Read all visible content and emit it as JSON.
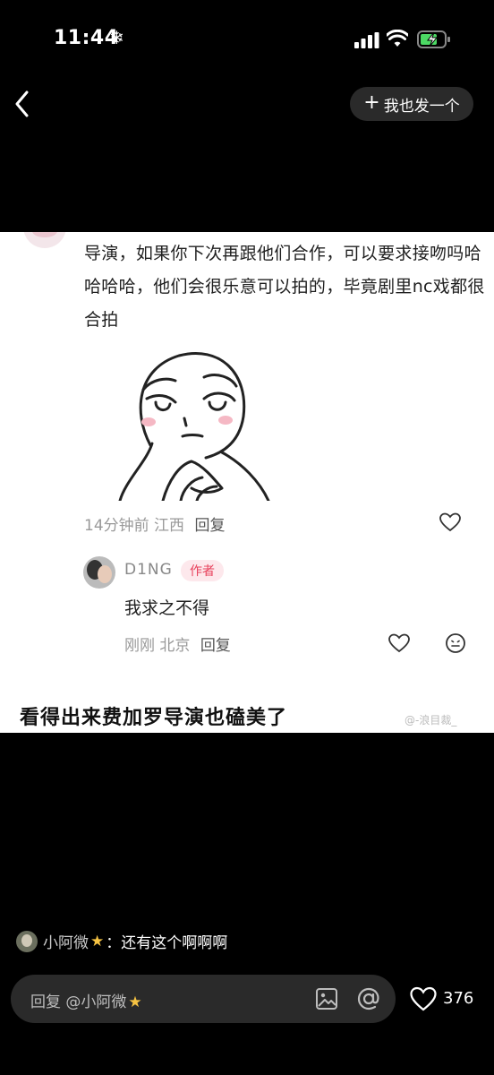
{
  "status": {
    "time": "11:44"
  },
  "nav": {
    "post_label": "我也发一个"
  },
  "comment": {
    "text": "导演，如果你下次再跟他们合作，可以要求接吻吗哈哈哈哈，他们会很乐意可以拍的，毕竟剧里nc戏都很合拍",
    "time": "14分钟前",
    "location": "江西",
    "reply_label": "回复"
  },
  "reply": {
    "name": "D1NG",
    "badge": "作者",
    "text": "我求之不得",
    "time": "刚刚",
    "location": "北京",
    "reply_label": "回复"
  },
  "caption": "看得出来费加罗导演也磕美了",
  "watermark": "@-浪目裁_",
  "bottom": {
    "preview_user": "小阿微",
    "preview_text": "：还有这个啊啊啊",
    "input_placeholder": "回复 @小阿微",
    "like_count": "376"
  },
  "colors": {
    "accent": "#e8405b",
    "badge_bg": "#fde8ec",
    "panel": "#ffffff",
    "background": "#000000"
  }
}
